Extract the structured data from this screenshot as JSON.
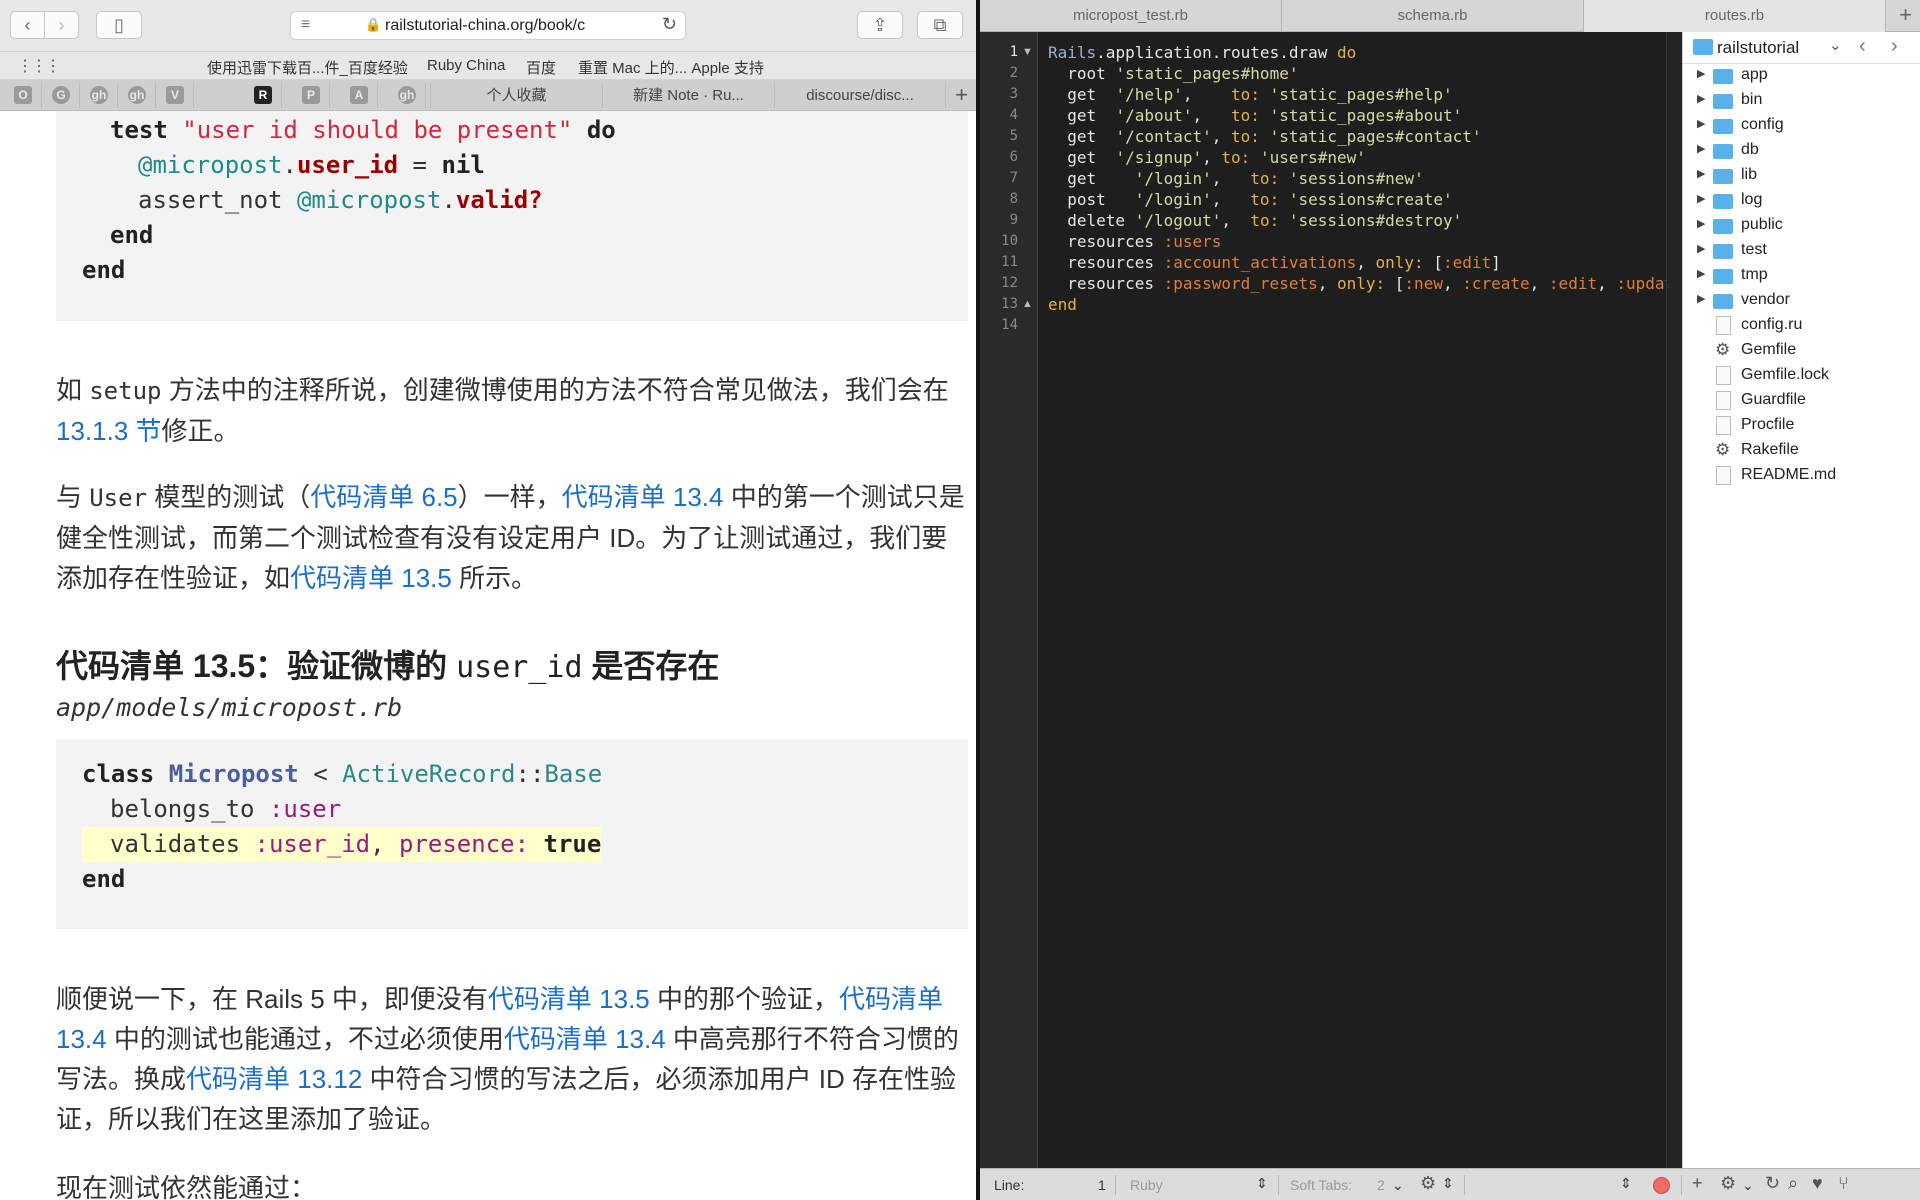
{
  "browser": {
    "url": "railstutorial-china.org/book/c",
    "bookmarks": [
      "使用迅雷下载百...件_百度经验",
      "Ruby China",
      "百度",
      "重置 Mac 上的... Apple 支持"
    ],
    "pinned_tabs": [
      "O",
      "G",
      "gh",
      "gh",
      "V",
      "R",
      "P",
      "A",
      "gh"
    ],
    "tabs": [
      "个人收藏",
      "新建 Note · Ru...",
      "discourse/disc..."
    ]
  },
  "article": {
    "code1": {
      "l1_kw": "test",
      "l1_str": "\"user id should be present\"",
      "l1_do": "do",
      "l2_ivar": "@micropost",
      "l2_meth": "user_id",
      "l2_rest": " = ",
      "l2_nil": "nil",
      "l3_plain": "assert_not ",
      "l3_ivar": "@micropost",
      "l3_meth": "valid?",
      "end": "end"
    },
    "p1": {
      "t1": "如 ",
      "code": "setup",
      "t2": " 方法中的注释所说，创建微博使用的方法不符合常见做法，我们会在 ",
      "link1": "13.1.3 节",
      "t3": "修正。"
    },
    "p2": {
      "t1": "与 ",
      "code": "User",
      "t2": " 模型的测试（",
      "link1": "代码清单 6.5",
      "t3": "）一样，",
      "link2": "代码清单 13.4",
      "t4": " 中的第一个测试只是健全性测试，而第二个测试检查有没有设定用户 ID。为了让测试通过，我们要添加存在性验证，如",
      "link3": "代码清单 13.5",
      "t5": " 所示。"
    },
    "heading": {
      "t1": "代码清单 13.5：验证微博的 ",
      "code": "user_id",
      "t2": " 是否存在"
    },
    "filepath": "app/models/micropost.rb",
    "code2": {
      "class_kw": "class",
      "class_name": "Micropost",
      "lt": " < ",
      "parent1": "ActiveRecord",
      "sep": "::",
      "parent2": "Base",
      "l2_plain": "belongs_to ",
      "l2_sym": ":user",
      "l3_plain": "validates ",
      "l3_sym": ":user_id",
      "l3_comma": ", ",
      "l3_key": "presence:",
      "l3_true": "true",
      "end": "end"
    },
    "p3": {
      "t1": "顺便说一下，在 Rails 5 中，即便没有",
      "link1": "代码清单 13.5",
      "t2": " 中的那个验证，",
      "link2": "代码清单 13.4",
      "t3": " 中的测试也能通过，不过必须使用",
      "link3": "代码清单 13.4",
      "t4": " 中高亮那行不符合习惯的写法。换成",
      "link4": "代码清单 13.12",
      "t5": " 中符合习惯的写法之后，必须添加用户 ID 存在性验证，所以我们在这里添加了验证。"
    },
    "p4": "现在测试依然能通过："
  },
  "editor": {
    "tabs": [
      "micropost_test.rb",
      "schema.rb",
      "routes.rb"
    ],
    "active_tab": "routes.rb",
    "line_numbers": [
      "1",
      "2",
      "3",
      "4",
      "5",
      "6",
      "7",
      "8",
      "9",
      "10",
      "11",
      "12",
      "13",
      "14"
    ],
    "code": {
      "l1a": "Rails",
      "l1b": ".application.routes.draw ",
      "l1c": "do",
      "l2a": "  root ",
      "l2b": "'static_pages#home'",
      "l3a": "  get  ",
      "l3b": "'/help'",
      "l3c": ",    ",
      "l3d": "to:",
      "l3e": " 'static_pages#help'",
      "l4a": "  get  ",
      "l4b": "'/about'",
      "l4c": ",   ",
      "l4d": "to:",
      "l4e": " 'static_pages#about'",
      "l5a": "  get  ",
      "l5b": "'/contact'",
      "l5c": ", ",
      "l5d": "to:",
      "l5e": " 'static_pages#contact'",
      "l6a": "  get  ",
      "l6b": "'/signup'",
      "l6c": ", ",
      "l6d": "to:",
      "l6e": " 'users#new'",
      "l7a": "  get    ",
      "l7b": "'/login'",
      "l7c": ",   ",
      "l7d": "to:",
      "l7e": " 'sessions#new'",
      "l8a": "  post   ",
      "l8b": "'/login'",
      "l8c": ",   ",
      "l8d": "to:",
      "l8e": " 'sessions#create'",
      "l9a": "  delete ",
      "l9b": "'/logout'",
      "l9c": ",  ",
      "l9d": "to:",
      "l9e": " 'sessions#destroy'",
      "l10a": "  resources ",
      "l10b": ":users",
      "l11a": "  resources ",
      "l11b": ":account_activations",
      "l11c": ", ",
      "l11d": "only:",
      "l11e": " [",
      "l11f": ":edit",
      "l11g": "]",
      "l12a": "  resources ",
      "l12b": ":password_resets",
      "l12c": ", ",
      "l12d": "only:",
      "l12e": " [",
      "l12f": ":new",
      "l12g": ", ",
      "l12h": ":create",
      "l12i": ", ",
      "l12j": ":edit",
      "l12k": ", ",
      "l12l": ":update",
      "l13": "end"
    },
    "project": "railstutorial",
    "files": [
      {
        "name": "app",
        "type": "folder"
      },
      {
        "name": "bin",
        "type": "folder"
      },
      {
        "name": "config",
        "type": "folder"
      },
      {
        "name": "db",
        "type": "folder"
      },
      {
        "name": "lib",
        "type": "folder"
      },
      {
        "name": "log",
        "type": "folder"
      },
      {
        "name": "public",
        "type": "folder"
      },
      {
        "name": "test",
        "type": "folder"
      },
      {
        "name": "tmp",
        "type": "folder"
      },
      {
        "name": "vendor",
        "type": "folder"
      },
      {
        "name": "config.ru",
        "type": "file"
      },
      {
        "name": "Gemfile",
        "type": "gear"
      },
      {
        "name": "Gemfile.lock",
        "type": "file"
      },
      {
        "name": "Guardfile",
        "type": "file"
      },
      {
        "name": "Procfile",
        "type": "file"
      },
      {
        "name": "Rakefile",
        "type": "gear"
      },
      {
        "name": "README.md",
        "type": "file"
      }
    ],
    "status": {
      "line_label": "Line:",
      "line_value": "1",
      "language": "Ruby",
      "tabs_label": "Soft Tabs:",
      "tabs_value": "2"
    }
  }
}
